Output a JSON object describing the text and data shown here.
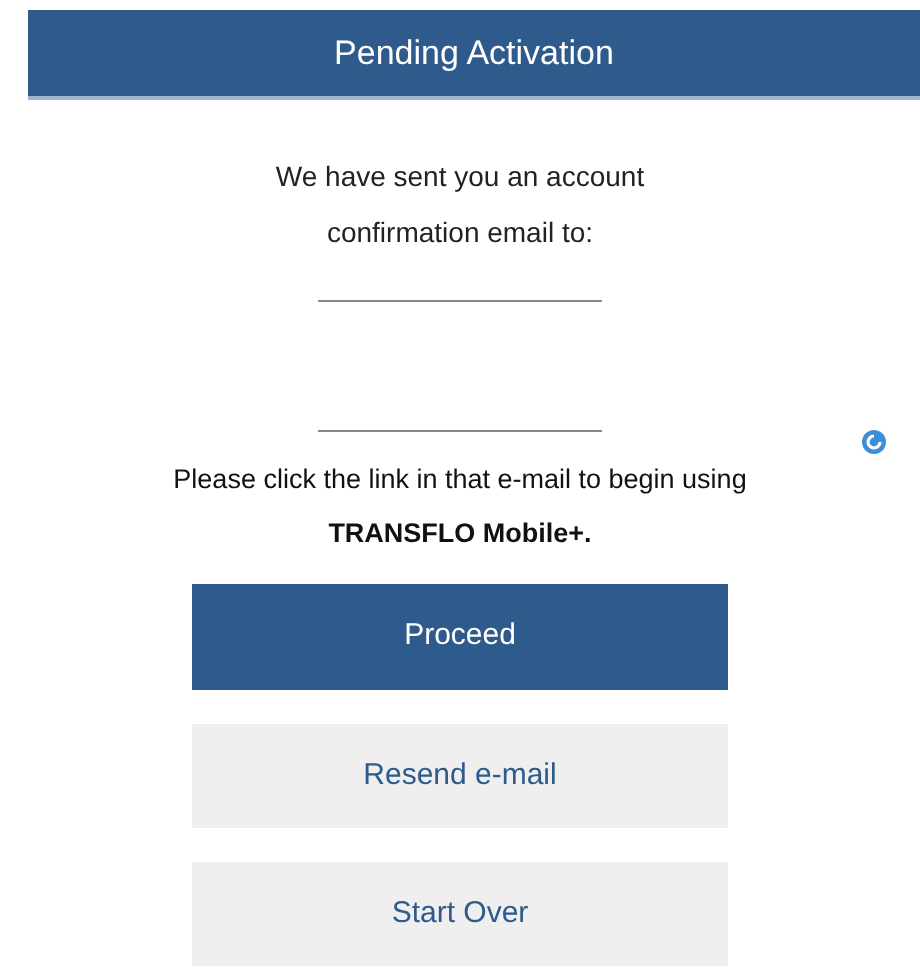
{
  "header": {
    "title": "Pending Activation"
  },
  "message": "We have sent you an account confirmation email to:",
  "instruction": "Please click the link in that e-mail to begin using **TRANSFLO Mobile+.**",
  "buttons": [
    {
      "label": "Proceed",
      "kind": "primary"
    },
    {
      "label": "Resend e-mail",
      "kind": "secondary"
    },
    {
      "label": "Start Over",
      "kind": "secondary"
    }
  ]
}
